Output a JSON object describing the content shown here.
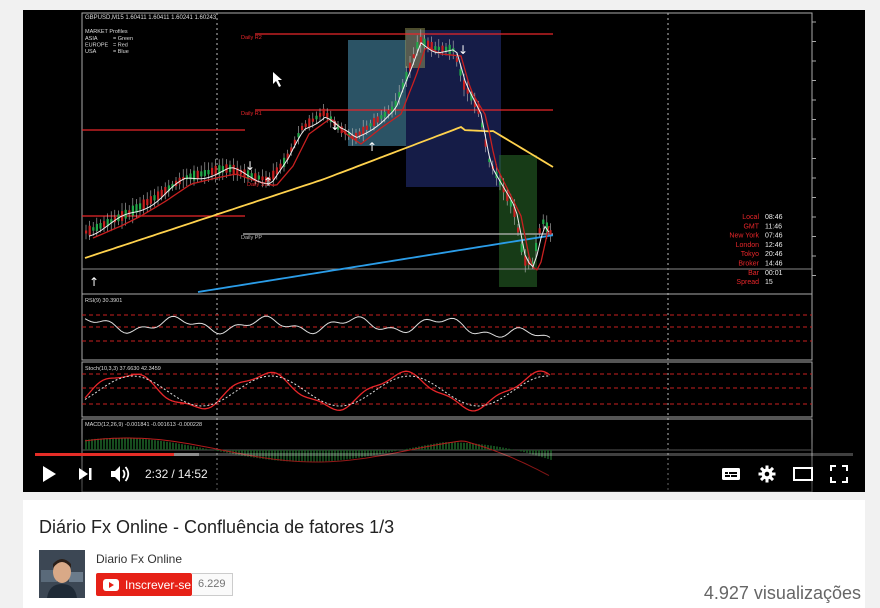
{
  "player": {
    "current_time": "2:32",
    "duration": "14:52",
    "progress_fraction": 0.17
  },
  "chart": {
    "symbol_header": "GBPUSD,M15  1.60411 1.60411 1.60241 1.60243",
    "market_profiles_title": "MARKET Profiles",
    "market_profiles": [
      {
        "session": "ASIA",
        "color": "= Green"
      },
      {
        "session": "EUROPE",
        "color": "= Red"
      },
      {
        "session": "USA",
        "color": "= Blue"
      }
    ],
    "level_labels": [
      "Daily R2",
      "Daily R1",
      "Daily S1",
      "Daily PP"
    ],
    "clock_rows": [
      {
        "label": "Local",
        "value": "08:46"
      },
      {
        "label": "GMT",
        "value": "11:46"
      },
      {
        "label": "New York",
        "value": "07:46"
      },
      {
        "label": "London",
        "value": "12:46"
      },
      {
        "label": "Tokyo",
        "value": "20:46"
      },
      {
        "label": "Broker",
        "value": "14:46"
      },
      {
        "label": "Bar",
        "value": "00:01"
      },
      {
        "label": "Spread",
        "value": "15"
      }
    ],
    "rsi_label": "RSI(9) 30.3901",
    "stoch_label": "Stoch(10,3,3) 37.6630 42.3459",
    "macd_label": "MACD(12,26,9) -0.001841 -0.001613 -0.000228",
    "colors": {
      "resistance_lines": "#e8262a",
      "ema_fast": "#ffd24d",
      "ema_slow": "#2b9de8",
      "asia_box": "#2a6b2a",
      "europe_box": "#5fb8e0",
      "usa_box": "#2f3f9e"
    }
  },
  "video": {
    "title": "Diário Fx Online - Confluência de fatores 1/3",
    "channel_name": "Diario Fx Online",
    "subscribe_label": "Inscrever-se",
    "subscriber_count": "6.229",
    "views": "4.927 visualizações"
  },
  "icons": [
    "play-icon",
    "next-icon",
    "volume-icon",
    "subtitles-icon",
    "settings-icon",
    "theater-mode-icon",
    "fullscreen-icon"
  ]
}
